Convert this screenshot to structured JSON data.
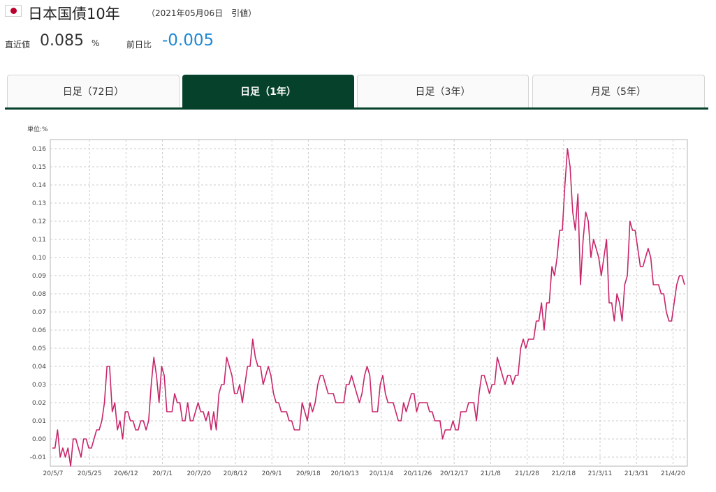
{
  "header": {
    "flag_icon": "japan-flag-icon",
    "title": "日本国債10年",
    "date": "（2021年05月06日",
    "close_label": "引値）"
  },
  "quote": {
    "latest_label": "直近値",
    "latest_value": "0.085",
    "unit": "%",
    "change_label": "前日比",
    "change_value": "-0.005",
    "change_color": "#1f88d3"
  },
  "tabs": [
    {
      "label": "日足（72日）",
      "active": false
    },
    {
      "label": "日足（1年）",
      "active": true
    },
    {
      "label": "日足（3年）",
      "active": false
    },
    {
      "label": "月足（5年）",
      "active": false
    }
  ],
  "colors": {
    "accent": "#06422b",
    "line": "#c8256b"
  },
  "chart_data": {
    "type": "line",
    "unit_label": "単位:%",
    "ylim": [
      -0.015,
      0.165
    ],
    "y_ticks": [
      "-0.01",
      "0.00",
      "0.01",
      "0.02",
      "0.03",
      "0.04",
      "0.05",
      "0.06",
      "0.07",
      "0.08",
      "0.09",
      "0.10",
      "0.11",
      "0.12",
      "0.13",
      "0.14",
      "0.15",
      "0.16"
    ],
    "x_tick_labels": [
      "20/5/7",
      "20/5/25",
      "20/6/12",
      "20/7/1",
      "20/7/20",
      "20/8/12",
      "20/9/1",
      "20/9/18",
      "20/10/13",
      "20/11/4",
      "20/11/26",
      "20/12/17",
      "21/1/8",
      "21/1/28",
      "21/2/18",
      "21/3/11",
      "21/3/31",
      "21/4/20"
    ],
    "grid": true,
    "series": [
      {
        "color": "#c8256b",
        "values": [
          -0.005,
          -0.005,
          0.005,
          -0.01,
          -0.005,
          -0.01,
          -0.005,
          -0.015,
          0.0,
          0.0,
          -0.005,
          -0.01,
          0.0,
          0.0,
          -0.005,
          -0.005,
          0.0,
          0.005,
          0.005,
          0.01,
          0.02,
          0.04,
          0.04,
          0.015,
          0.02,
          0.005,
          0.01,
          0.0,
          0.015,
          0.015,
          0.01,
          0.01,
          0.005,
          0.005,
          0.01,
          0.01,
          0.005,
          0.01,
          0.03,
          0.045,
          0.035,
          0.02,
          0.04,
          0.035,
          0.015,
          0.015,
          0.015,
          0.025,
          0.02,
          0.02,
          0.01,
          0.01,
          0.02,
          0.01,
          0.01,
          0.015,
          0.02,
          0.015,
          0.015,
          0.01,
          0.015,
          0.005,
          0.015,
          0.005,
          0.025,
          0.03,
          0.03,
          0.045,
          0.04,
          0.035,
          0.025,
          0.025,
          0.03,
          0.02,
          0.03,
          0.04,
          0.04,
          0.055,
          0.045,
          0.04,
          0.04,
          0.03,
          0.035,
          0.04,
          0.035,
          0.025,
          0.02,
          0.02,
          0.015,
          0.015,
          0.015,
          0.01,
          0.01,
          0.005,
          0.005,
          0.005,
          0.02,
          0.015,
          0.01,
          0.02,
          0.015,
          0.02,
          0.03,
          0.035,
          0.035,
          0.03,
          0.025,
          0.025,
          0.025,
          0.02,
          0.02,
          0.02,
          0.02,
          0.03,
          0.03,
          0.035,
          0.03,
          0.025,
          0.02,
          0.025,
          0.035,
          0.04,
          0.035,
          0.015,
          0.015,
          0.015,
          0.03,
          0.035,
          0.025,
          0.02,
          0.02,
          0.02,
          0.015,
          0.01,
          0.01,
          0.02,
          0.015,
          0.02,
          0.025,
          0.025,
          0.015,
          0.02,
          0.02,
          0.02,
          0.02,
          0.015,
          0.015,
          0.01,
          0.01,
          0.01,
          0.0,
          0.005,
          0.005,
          0.005,
          0.01,
          0.005,
          0.005,
          0.015,
          0.015,
          0.015,
          0.02,
          0.02,
          0.02,
          0.01,
          0.025,
          0.035,
          0.035,
          0.03,
          0.025,
          0.03,
          0.03,
          0.045,
          0.04,
          0.035,
          0.03,
          0.035,
          0.035,
          0.03,
          0.035,
          0.035,
          0.05,
          0.055,
          0.05,
          0.055,
          0.055,
          0.055,
          0.065,
          0.065,
          0.075,
          0.06,
          0.075,
          0.075,
          0.095,
          0.09,
          0.1,
          0.115,
          0.115,
          0.14,
          0.16,
          0.15,
          0.125,
          0.115,
          0.135,
          0.085,
          0.11,
          0.125,
          0.12,
          0.1,
          0.11,
          0.105,
          0.1,
          0.09,
          0.1,
          0.11,
          0.075,
          0.075,
          0.065,
          0.08,
          0.075,
          0.065,
          0.085,
          0.09,
          0.12,
          0.115,
          0.115,
          0.105,
          0.095,
          0.095,
          0.1,
          0.105,
          0.1,
          0.085,
          0.085,
          0.085,
          0.08,
          0.08,
          0.07,
          0.065,
          0.065,
          0.075,
          0.085,
          0.09,
          0.09,
          0.085
        ]
      }
    ]
  }
}
